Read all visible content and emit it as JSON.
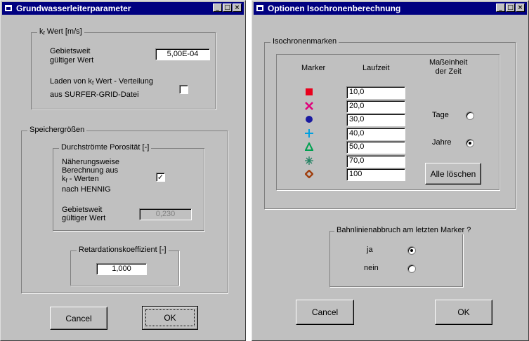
{
  "left": {
    "title": "Grundwasserleiterparameter",
    "kf_group": {
      "legend_pre": "k",
      "legend_sub": "f",
      "legend_post": " Wert [m/s]",
      "area_label_line1": "Gebietsweit",
      "area_label_line2": "gültiger Wert",
      "area_value": "5,00E-04",
      "load_label_line1_pre": "Laden von k",
      "load_label_line1_sub": "f",
      "load_label_line1_post": " Wert - Verteilung",
      "load_label_line2": "aus SURFER-GRID-Datei",
      "load_checked": false
    },
    "storage_group": {
      "legend": "Speichergrößen",
      "porosity": {
        "legend": "Durchströmte Porosität [-]",
        "approx_line1": "Näherungsweise",
        "approx_line2": "Berechnung aus",
        "approx_line3_pre": "k",
        "approx_line3_sub": "f",
        "approx_line3_post": " - Werten",
        "approx_line4": "nach HENNIG",
        "approx_checked": true,
        "area_label_line1": "Gebietsweit",
        "area_label_line2": "gültiger Wert",
        "area_value": "0,230"
      },
      "retardation": {
        "legend": "Retardationskoeffizient [-]",
        "value": "1,000"
      }
    },
    "buttons": {
      "cancel": "Cancel",
      "ok": "OK"
    }
  },
  "right": {
    "title": "Optionen Isochronenberechnung",
    "marker_group": {
      "legend": "Isochronenmarken",
      "col_marker": "Marker",
      "col_time": "Laufzeit",
      "col_unit_line1": "Maßeinheit",
      "col_unit_line2": "der Zeit",
      "rows": [
        {
          "symbol": "square",
          "color": "#e8001c",
          "value": "10,0"
        },
        {
          "symbol": "x",
          "color": "#e0007a",
          "value": "20,0"
        },
        {
          "symbol": "circle",
          "color": "#1a1aa0",
          "value": "30,0"
        },
        {
          "symbol": "plus",
          "color": "#00a0e0",
          "value": "40,0"
        },
        {
          "symbol": "triangle",
          "color": "#00a050",
          "value": "50,0"
        },
        {
          "symbol": "asterisk",
          "color": "#208060",
          "value": "70,0"
        },
        {
          "symbol": "diamond",
          "color": "#a04010",
          "value": "100"
        }
      ],
      "unit_days": "Tage",
      "unit_years": "Jahre",
      "selected_unit": "Jahre",
      "clear_button": "Alle löschen"
    },
    "abort_group": {
      "legend": "Bahnlinienabbruch am letzten Marker ?",
      "yes": "ja",
      "no": "nein",
      "selected": "ja"
    },
    "buttons": {
      "cancel": "Cancel",
      "ok": "OK"
    }
  }
}
